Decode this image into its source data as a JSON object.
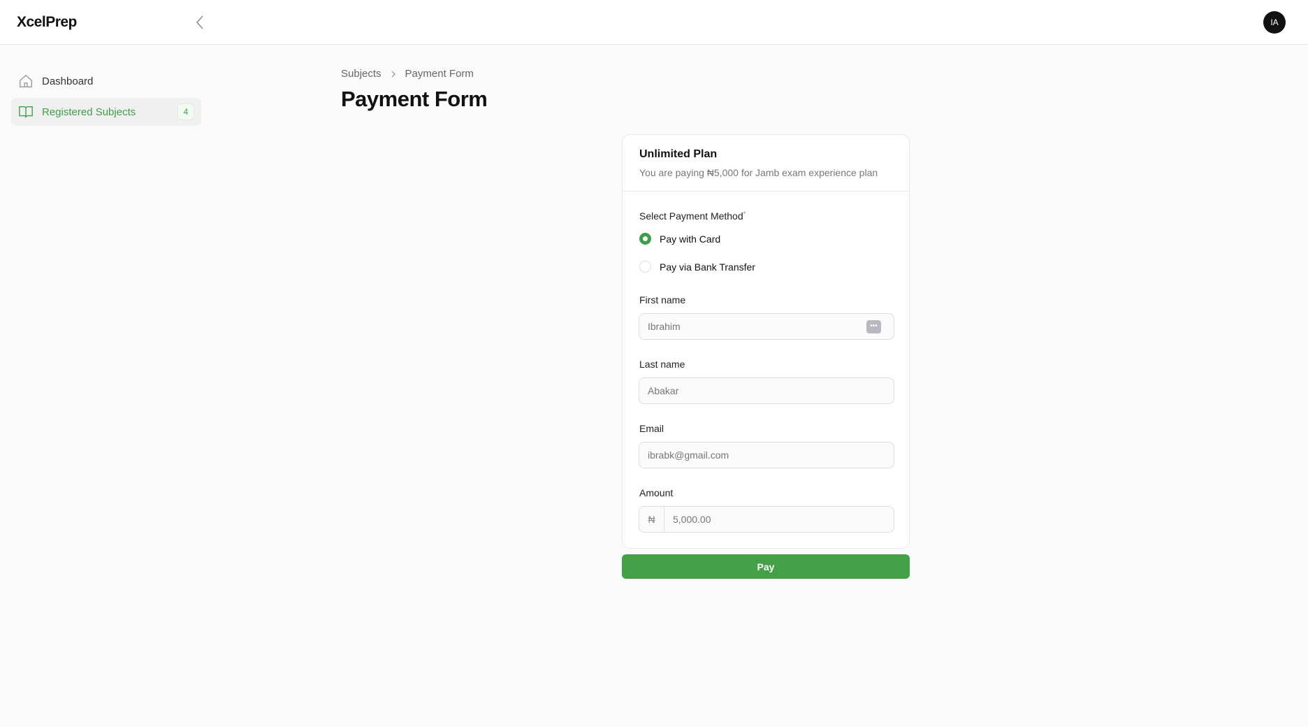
{
  "header": {
    "logo": "XcelPrep",
    "avatar_initials": "IA"
  },
  "sidebar": {
    "items": [
      {
        "label": "Dashboard",
        "icon": "home-icon"
      },
      {
        "label": "Registered Subjects",
        "icon": "book-open-icon",
        "badge": "4",
        "active": true
      }
    ]
  },
  "breadcrumb": [
    "Subjects",
    "Payment Form"
  ],
  "page_title": "Payment Form",
  "card": {
    "plan_title": "Unlimited Plan",
    "plan_desc": "You are paying ₦5,000 for Jamb exam experience plan",
    "payment_label": "Select Payment Method",
    "required_mark": "*",
    "options": [
      {
        "label": "Pay with Card",
        "selected": true
      },
      {
        "label": "Pay via Bank Transfer",
        "selected": false
      }
    ],
    "fields": {
      "first_name": {
        "label": "First name",
        "value": "Ibrahim"
      },
      "last_name": {
        "label": "Last name",
        "value": "Abakar"
      },
      "email": {
        "label": "Email",
        "value": "ibrabk@gmail.com"
      },
      "amount": {
        "label": "Amount",
        "currency": "₦",
        "value": "5,000.00"
      }
    }
  },
  "pay_label": "Pay",
  "colors": {
    "accent": "#43a047"
  }
}
